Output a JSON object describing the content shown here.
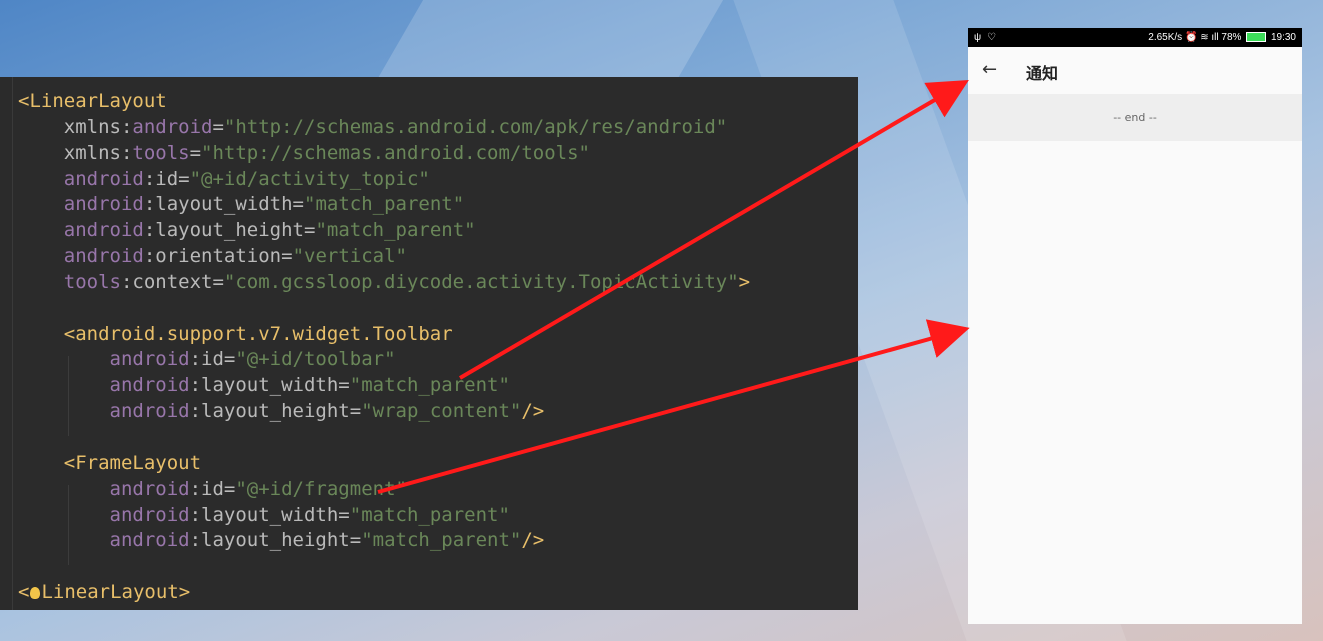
{
  "code": {
    "lines": [
      [
        {
          "c": "tag",
          "t": "<LinearLayout"
        }
      ],
      [
        {
          "c": "plain",
          "t": "    xmlns:"
        },
        {
          "c": "ns",
          "t": "android"
        },
        {
          "c": "plain",
          "t": "="
        },
        {
          "c": "val",
          "t": "\"http://schemas.android.com/apk/res/android\""
        }
      ],
      [
        {
          "c": "plain",
          "t": "    xmlns:"
        },
        {
          "c": "ns",
          "t": "tools"
        },
        {
          "c": "plain",
          "t": "="
        },
        {
          "c": "val",
          "t": "\"http://schemas.android.com/tools\""
        }
      ],
      [
        {
          "c": "ns",
          "t": "    android"
        },
        {
          "c": "plain",
          "t": ":id="
        },
        {
          "c": "val",
          "t": "\"@+id/activity_topic\""
        }
      ],
      [
        {
          "c": "ns",
          "t": "    android"
        },
        {
          "c": "plain",
          "t": ":layout_width="
        },
        {
          "c": "val",
          "t": "\"match_parent\""
        }
      ],
      [
        {
          "c": "ns",
          "t": "    android"
        },
        {
          "c": "plain",
          "t": ":layout_height="
        },
        {
          "c": "val",
          "t": "\"match_parent\""
        }
      ],
      [
        {
          "c": "ns",
          "t": "    android"
        },
        {
          "c": "plain",
          "t": ":orientation="
        },
        {
          "c": "val",
          "t": "\"vertical\""
        }
      ],
      [
        {
          "c": "ns",
          "t": "    tools"
        },
        {
          "c": "plain",
          "t": ":context="
        },
        {
          "c": "val",
          "t": "\"com.gcssloop.diycode.activity.TopicActivity\""
        },
        {
          "c": "tag",
          "t": ">"
        }
      ],
      [
        {
          "c": "plain",
          "t": ""
        }
      ],
      [
        {
          "c": "tag",
          "t": "    <android.support.v7.widget.Toolbar"
        }
      ],
      [
        {
          "c": "ns",
          "t": "        android"
        },
        {
          "c": "plain",
          "t": ":id="
        },
        {
          "c": "val",
          "t": "\"@+id/toolbar\""
        }
      ],
      [
        {
          "c": "ns",
          "t": "        android"
        },
        {
          "c": "plain",
          "t": ":layout_width="
        },
        {
          "c": "val",
          "t": "\"match_parent\""
        }
      ],
      [
        {
          "c": "ns",
          "t": "        android"
        },
        {
          "c": "plain",
          "t": ":layout_height="
        },
        {
          "c": "val",
          "t": "\"wrap_content\""
        },
        {
          "c": "tag",
          "t": "/>"
        }
      ],
      [
        {
          "c": "plain",
          "t": ""
        }
      ],
      [
        {
          "c": "tag",
          "t": "    <FrameLayout"
        }
      ],
      [
        {
          "c": "ns",
          "t": "        android"
        },
        {
          "c": "plain",
          "t": ":id="
        },
        {
          "c": "val",
          "t": "\"@+id/fragment\""
        }
      ],
      [
        {
          "c": "ns",
          "t": "        android"
        },
        {
          "c": "plain",
          "t": ":layout_width="
        },
        {
          "c": "val",
          "t": "\"match_parent\""
        }
      ],
      [
        {
          "c": "ns",
          "t": "        android"
        },
        {
          "c": "plain",
          "t": ":layout_height="
        },
        {
          "c": "val",
          "t": "\"match_parent\""
        },
        {
          "c": "tag",
          "t": "/>"
        }
      ],
      [
        {
          "c": "plain",
          "t": ""
        }
      ],
      [
        {
          "c": "tag",
          "t": "<"
        },
        {
          "c": "bulb",
          "t": ""
        },
        {
          "c": "tag",
          "t": "LinearLayout>"
        }
      ]
    ]
  },
  "phone": {
    "status": {
      "left_icons": [
        "usb-icon",
        "shield-icon"
      ],
      "right_text": "2.65K/s",
      "battery": "78%",
      "time": "19:30"
    },
    "toolbar": {
      "back_icon": "←",
      "title": "通知"
    },
    "list_end_text": "-- end --"
  },
  "colors": {
    "arrow": "#ff1a1a",
    "editor_bg": "#2b2b2b"
  }
}
